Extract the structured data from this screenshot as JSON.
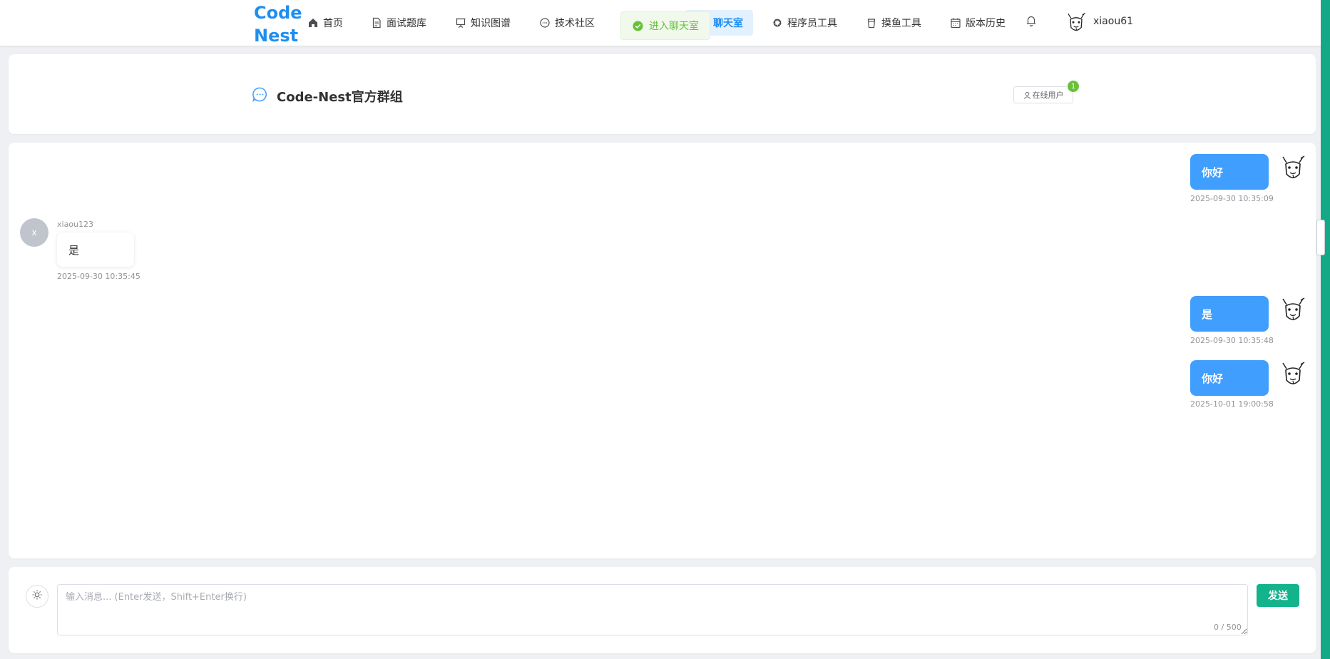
{
  "nav": {
    "logo_line1": "Code",
    "logo_line2": "Nest",
    "items": [
      {
        "label": "首页",
        "icon": "home-icon"
      },
      {
        "label": "面试题库",
        "icon": "document-icon"
      },
      {
        "label": "知识图谱",
        "icon": "presentation-icon"
      },
      {
        "label": "技术社区",
        "icon": "chat-bubble-icon"
      },
      {
        "label": "聊天室",
        "icon": "chat-icon",
        "active": true
      },
      {
        "label": "程序员工具",
        "icon": "gear-icon"
      },
      {
        "label": "摸鱼工具",
        "icon": "cup-icon"
      },
      {
        "label": "版本历史",
        "icon": "calendar-icon"
      }
    ],
    "username": "xiaou61"
  },
  "toast": {
    "text": "进入聊天室",
    "type": "success"
  },
  "chat_header": {
    "title": "Code-Nest官方群组",
    "online_button": "在线用户",
    "online_count": "1"
  },
  "messages": [
    {
      "side": "right",
      "text": "你好",
      "time": "2025-09-30 10:35:09"
    },
    {
      "side": "left",
      "sender": "xiaou123",
      "avatar_letter": "x",
      "text": "是",
      "time": "2025-09-30 10:35:45"
    },
    {
      "side": "right",
      "text": "是",
      "time": "2025-09-30 10:35:48"
    },
    {
      "side": "right",
      "text": "你好",
      "time": "2025-10-01 19:00:58"
    }
  ],
  "composer": {
    "placeholder": "输入消息... (Enter发送，Shift+Enter换行)",
    "counter": "0 / 500",
    "send_label": "发送"
  },
  "colors": {
    "brand": "#1e8ef0",
    "bubble_self": "#409eff",
    "send_button": "#13b38b",
    "toast_success": "#67c23a",
    "side_strip": "#13a886"
  }
}
